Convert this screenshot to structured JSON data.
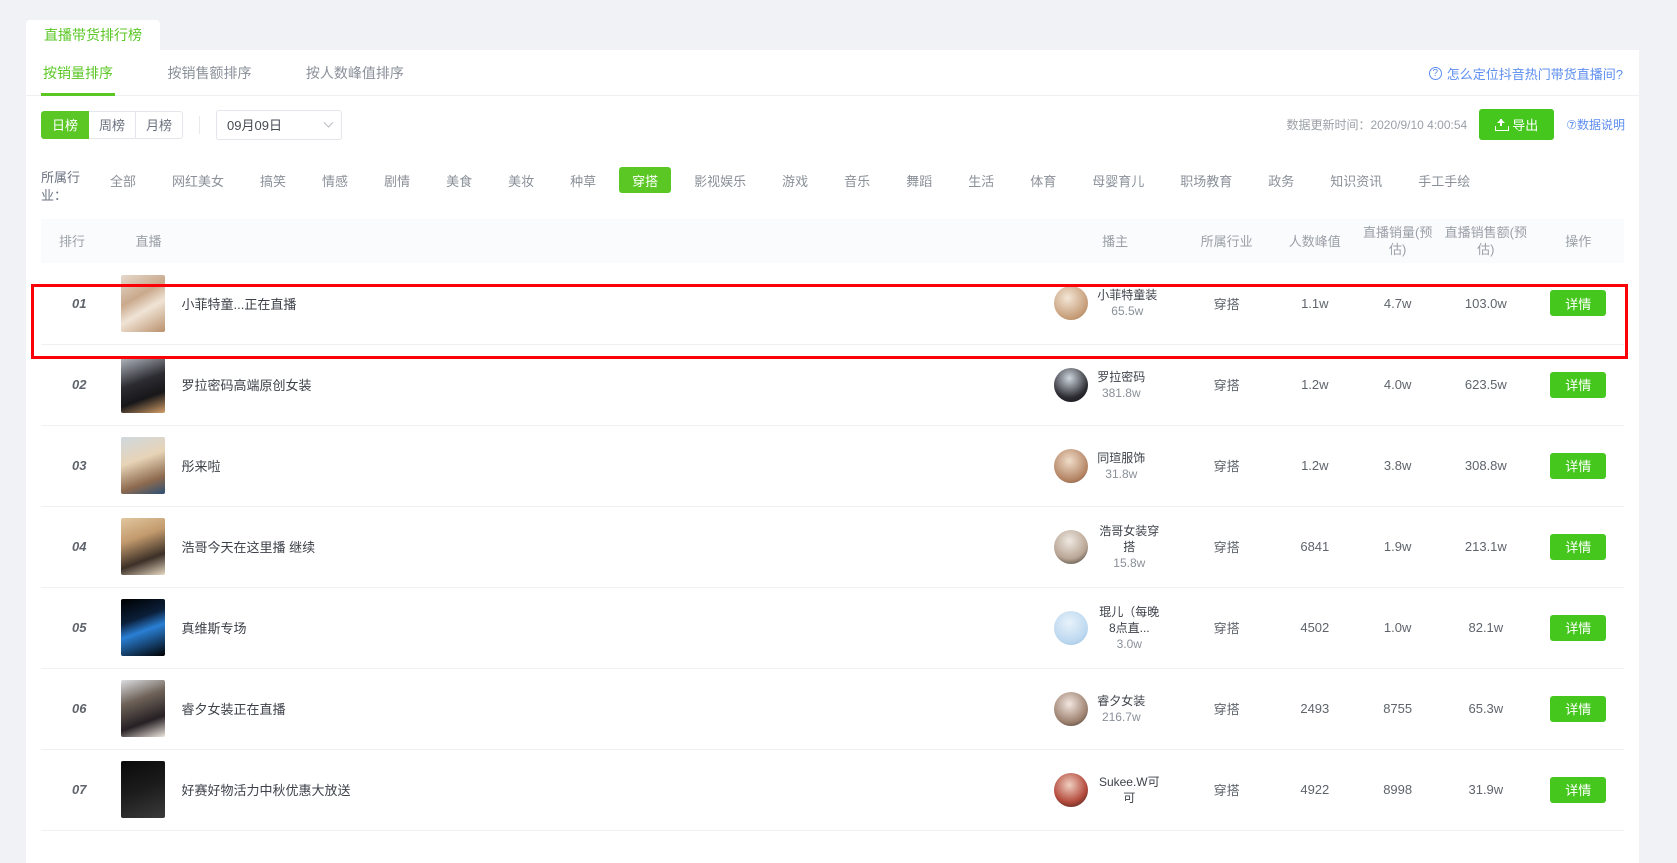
{
  "tab": {
    "label": "直播带货排行榜"
  },
  "sort_tabs": [
    {
      "label": "按销量排序",
      "active": true
    },
    {
      "label": "按销售额排序",
      "active": false
    },
    {
      "label": "按人数峰值排序",
      "active": false
    }
  ],
  "help_link": {
    "icon": "question-circle-icon",
    "label": "怎么定位抖音热门带货直播间?"
  },
  "range_tabs": [
    {
      "label": "日榜",
      "active": true
    },
    {
      "label": "周榜",
      "active": false
    },
    {
      "label": "月榜",
      "active": false
    }
  ],
  "date_picker": {
    "value": "09月09日",
    "icon": "chevron-down-icon"
  },
  "update_time": "数据更新时间：2020/9/10 4:00:54",
  "export_button": {
    "label": "导出",
    "icon": "upload-icon"
  },
  "data_info_link": {
    "icon": "question-circle-icon",
    "label": "数据说明"
  },
  "industry_filter": {
    "label": "所属行业：",
    "items": [
      {
        "label": "全部",
        "active": false
      },
      {
        "label": "网红美女",
        "active": false
      },
      {
        "label": "搞笑",
        "active": false
      },
      {
        "label": "情感",
        "active": false
      },
      {
        "label": "剧情",
        "active": false
      },
      {
        "label": "美食",
        "active": false
      },
      {
        "label": "美妆",
        "active": false
      },
      {
        "label": "种草",
        "active": false
      },
      {
        "label": "穿搭",
        "active": true
      },
      {
        "label": "影视娱乐",
        "active": false
      },
      {
        "label": "游戏",
        "active": false
      },
      {
        "label": "音乐",
        "active": false
      },
      {
        "label": "舞蹈",
        "active": false
      },
      {
        "label": "生活",
        "active": false
      },
      {
        "label": "体育",
        "active": false
      },
      {
        "label": "母婴育儿",
        "active": false
      },
      {
        "label": "职场教育",
        "active": false
      },
      {
        "label": "政务",
        "active": false
      },
      {
        "label": "知识资讯",
        "active": false
      },
      {
        "label": "手工手绘",
        "active": false
      }
    ]
  },
  "table": {
    "columns": [
      "排行",
      "直播",
      "播主",
      "所属行业",
      "人数峰值",
      "直播销量(预估)",
      "直播销售额(预估)",
      "操作"
    ],
    "action_label": "详情",
    "rows": [
      {
        "rank": "01",
        "live_title": "小菲特童...正在直播",
        "anchor_name": "小菲特童装",
        "anchor_fans": "65.5w",
        "industry": "穿搭",
        "peak_viewers": "1.1w",
        "sales_volume": "4.7w",
        "sales_amount": "103.0w",
        "highlighted": true
      },
      {
        "rank": "02",
        "live_title": "罗拉密码高端原创女装",
        "anchor_name": "罗拉密码",
        "anchor_fans": "381.8w",
        "industry": "穿搭",
        "peak_viewers": "1.2w",
        "sales_volume": "4.0w",
        "sales_amount": "623.5w",
        "highlighted": false
      },
      {
        "rank": "03",
        "live_title": "彤来啦",
        "anchor_name": "同瑄服饰",
        "anchor_fans": "31.8w",
        "industry": "穿搭",
        "peak_viewers": "1.2w",
        "sales_volume": "3.8w",
        "sales_amount": "308.8w",
        "highlighted": false
      },
      {
        "rank": "04",
        "live_title": "浩哥今天在这里播 继续",
        "anchor_name": "浩哥女装穿搭",
        "anchor_fans": "15.8w",
        "industry": "穿搭",
        "peak_viewers": "6841",
        "sales_volume": "1.9w",
        "sales_amount": "213.1w",
        "highlighted": false
      },
      {
        "rank": "05",
        "live_title": "真维斯专场",
        "anchor_name": "琨儿（每晚8点直...",
        "anchor_fans": "3.0w",
        "industry": "穿搭",
        "peak_viewers": "4502",
        "sales_volume": "1.0w",
        "sales_amount": "82.1w",
        "highlighted": false
      },
      {
        "rank": "06",
        "live_title": "睿夕女装正在直播",
        "anchor_name": "睿夕女装",
        "anchor_fans": "216.7w",
        "industry": "穿搭",
        "peak_viewers": "2493",
        "sales_volume": "8755",
        "sales_amount": "65.3w",
        "highlighted": false
      },
      {
        "rank": "07",
        "live_title": "好赛好物活力中秋优惠大放送",
        "anchor_name": "Sukee.W可可",
        "anchor_fans": "",
        "industry": "穿搭",
        "peak_viewers": "4922",
        "sales_volume": "8998",
        "sales_amount": "31.9w",
        "highlighted": false
      }
    ]
  },
  "colors": {
    "brand_green": "#5ac725",
    "button_green": "#46c71e",
    "link_blue": "#5c8df0",
    "highlight_red": "#fb0007"
  }
}
